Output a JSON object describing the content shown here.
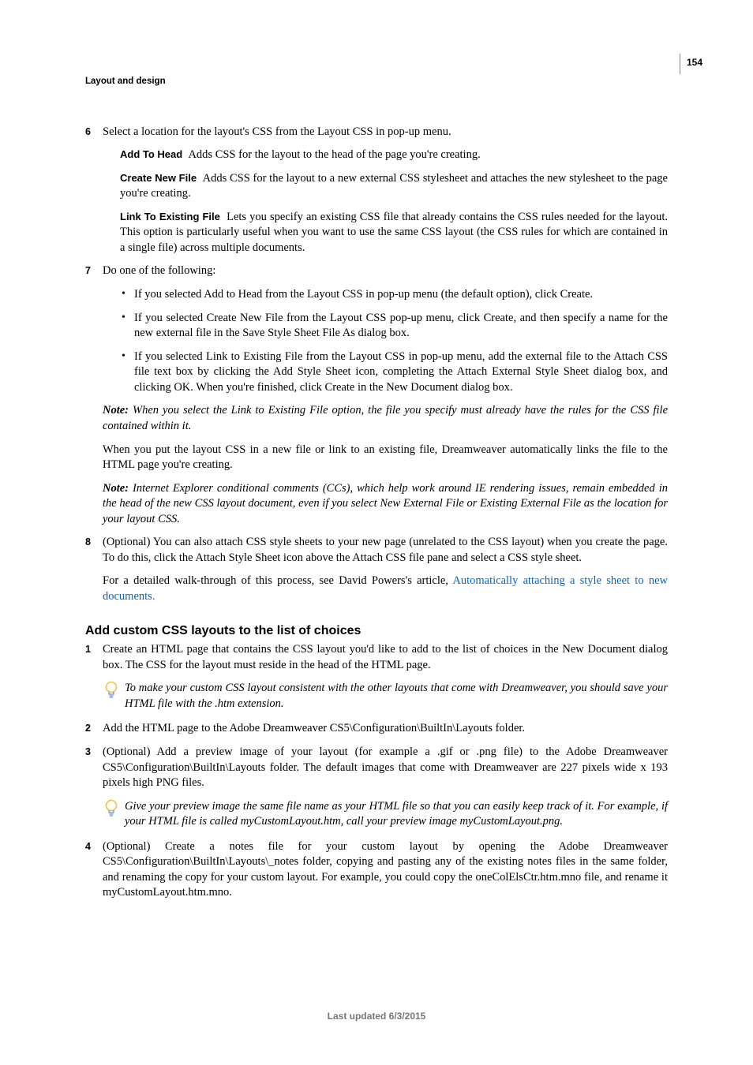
{
  "pageNumber": "154",
  "sectionTitle": "Layout and design",
  "step6": {
    "num": "6",
    "intro": "Select a location for the layout's CSS from the Layout CSS in pop-up menu.",
    "addToHead": {
      "label": "Add To Head",
      "text": "Adds CSS for the layout to the head of the page you're creating."
    },
    "createNewFile": {
      "label": "Create New File",
      "text": "Adds CSS for the layout to a new external CSS stylesheet and attaches the new stylesheet to the page you're creating."
    },
    "linkExisting": {
      "label": "Link To Existing File",
      "text": "Lets you specify an existing CSS file that already contains the CSS rules needed for the layout. This option is particularly useful when you want to use the same CSS layout (the CSS rules for which are contained in a single file) across multiple documents."
    }
  },
  "step7": {
    "num": "7",
    "intro": "Do one of the following:",
    "b1": "If you selected Add to Head from the Layout CSS in pop-up menu (the default option), click Create.",
    "b2": "If you selected Create New File from the Layout CSS pop-up menu, click Create, and then specify a name for the new external file in the Save Style Sheet File As dialog box.",
    "b3": "If you selected Link to Existing File from the Layout CSS in pop-up menu, add the external file to the Attach CSS file text box by clicking the Add Style Sheet icon, completing the Attach External Style Sheet dialog box, and clicking OK. When you're finished, click Create in the New Document dialog box.",
    "note1Label": "Note:",
    "note1": "When you select the Link to Existing File option, the file you specify must already have the rules for the CSS file contained within it.",
    "afterNote": "When you put the layout CSS in a new file or link to an existing file, Dreamweaver automatically links the file to the HTML page you're creating.",
    "note2Label": "Note:",
    "note2": "Internet Explorer conditional comments (CCs), which help work around IE rendering issues, remain embedded in the head of the new CSS layout document, even if you select New External File or Existing External File as the location for your layout CSS."
  },
  "step8": {
    "num": "8",
    "p1": "(Optional) You can also attach CSS style sheets to your new page (unrelated to the CSS layout) when you create the page. To do this, click the Attach Style Sheet icon above the Attach CSS file pane and select a CSS style sheet.",
    "p2a": "For a detailed walk-through of this process, see David Powers's article, ",
    "p2link": "Automatically attaching a style sheet to new documents."
  },
  "subheading": "Add custom CSS layouts to the list of choices",
  "custom": {
    "s1num": "1",
    "s1": "Create an HTML page that contains the CSS layout you'd like to add to the list of choices in the New Document dialog box. The CSS for the layout must reside in the head of the HTML page.",
    "tip1": "To make your custom CSS layout consistent with the other layouts that come with Dreamweaver, you should save your HTML file with the .htm extension.",
    "s2num": "2",
    "s2": "Add the HTML page to the Adobe Dreamweaver CS5\\Configuration\\BuiltIn\\Layouts folder.",
    "s3num": "3",
    "s3": "(Optional) Add a preview image of your layout (for example a .gif or .png file) to the Adobe Dreamweaver CS5\\Configuration\\BuiltIn\\Layouts folder. The default images that come with Dreamweaver are 227 pixels wide x 193 pixels high PNG files.",
    "tip2": "Give your preview image the same file name as your HTML file so that you can easily keep track of it. For example, if your HTML file is called myCustomLayout.htm, call your preview image myCustomLayout.png.",
    "s4num": "4",
    "s4": "(Optional) Create a notes file for your custom layout by opening the Adobe Dreamweaver CS5\\Configuration\\BuiltIn\\Layouts\\_notes folder, copying and pasting any of the existing notes files in the same folder, and renaming the copy for your custom layout. For example, you could copy the oneColElsCtr.htm.mno file, and rename it myCustomLayout.htm.mno."
  },
  "footer": "Last updated 6/3/2015"
}
